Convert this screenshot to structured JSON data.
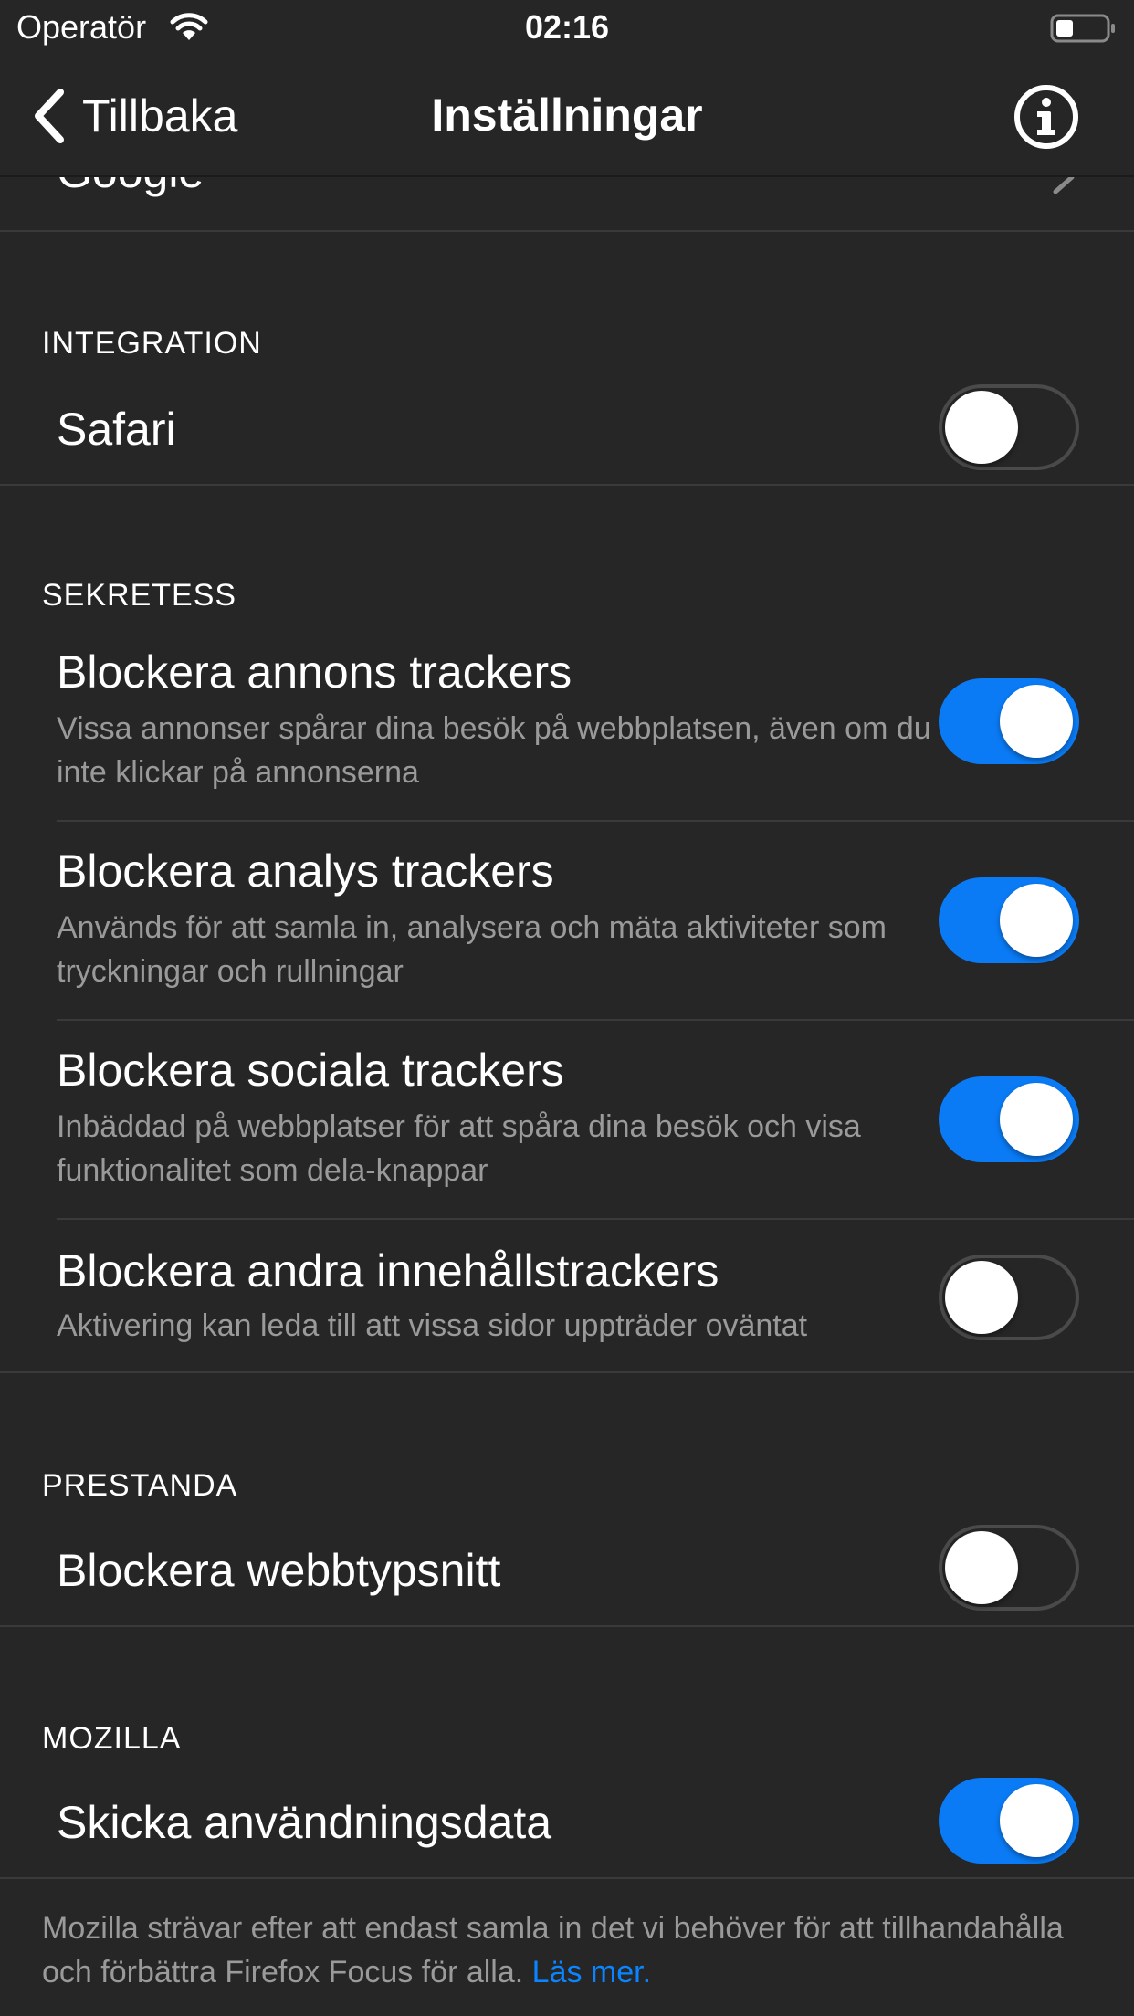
{
  "status_bar": {
    "carrier": "Operatör",
    "time": "02:16"
  },
  "nav": {
    "back_label": "Tillbaka",
    "title": "Inställningar"
  },
  "search": {
    "engine": "Google"
  },
  "sections": {
    "integration": {
      "header": "INTEGRATION",
      "safari": {
        "label": "Safari",
        "enabled": false
      }
    },
    "privacy": {
      "header": "SEKRETESS",
      "items": [
        {
          "label": "Blockera annons trackers",
          "description": "Vissa annonser spårar dina besök på webbplatsen, även om du inte klickar på annonserna",
          "enabled": true
        },
        {
          "label": "Blockera analys trackers",
          "description": "Används för att samla in, analysera och mäta aktiviteter som tryckningar och rullningar",
          "enabled": true
        },
        {
          "label": "Blockera sociala trackers",
          "description": "Inbäddad på webbplatser för att spåra dina besök och visa funktionalitet som dela-knappar",
          "enabled": true
        },
        {
          "label": "Blockera andra innehållstrackers",
          "description": "Aktivering kan leda till att vissa sidor uppträder oväntat",
          "enabled": false
        }
      ]
    },
    "performance": {
      "header": "PRESTANDA",
      "web_fonts": {
        "label": "Blockera webbtypsnitt",
        "enabled": false
      }
    },
    "mozilla": {
      "header": "MOZILLA",
      "usage_data": {
        "label": "Skicka användningsdata",
        "enabled": true
      },
      "footer": "Mozilla strävar efter att endast samla in det vi behöver för att tillhandahålla och förbättra Firefox Focus för alla.",
      "learn_more": "Läs mer."
    }
  },
  "colors": {
    "background": "#262626",
    "accent": "#0a7bf5",
    "link": "#0a84ff",
    "secondary_text": "#9a9a9a"
  }
}
